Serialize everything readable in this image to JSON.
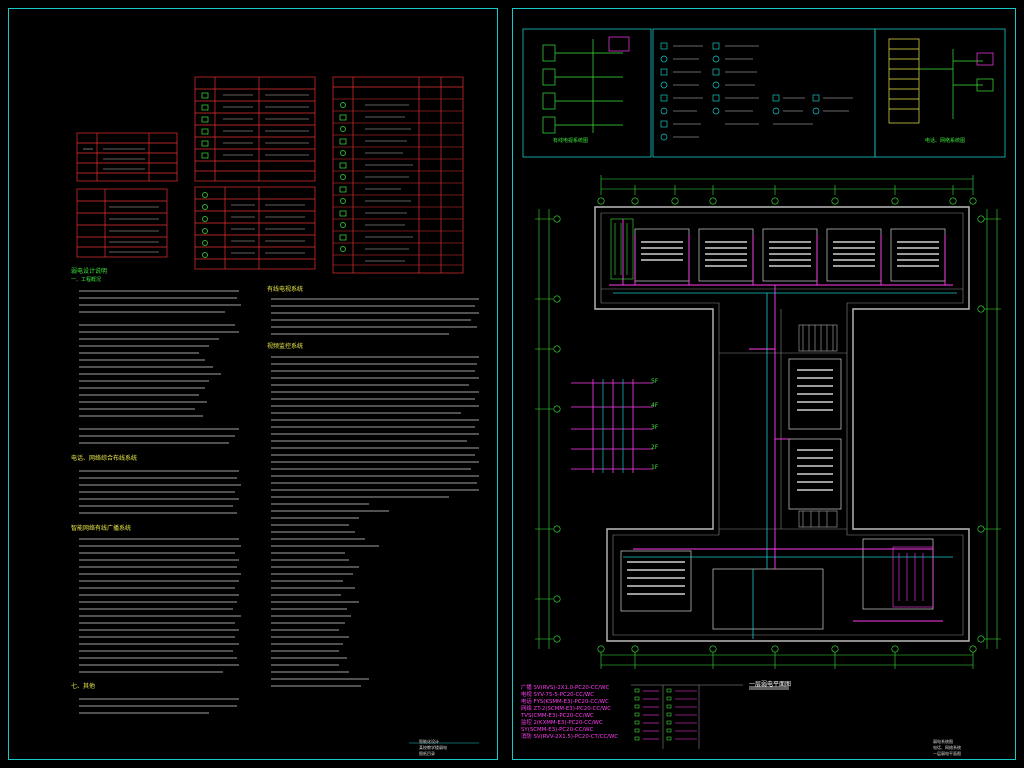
{
  "left_sheet": {
    "title_block": [
      "智能化设计",
      "某校教学楼弱电",
      "图纸目录"
    ],
    "headings": {
      "design_notes": "弱电设计说明",
      "general": "一、工程概况",
      "network": "电话、网络综合布线系统",
      "cable_tv": "有线电视系统",
      "monitor": "视频监控系统",
      "broadcast": "智能网络有线广播系统",
      "notes": "七、其他"
    }
  },
  "right_sheet": {
    "plan_title": "一层弱电平面图",
    "title_block": [
      "弱电系统图",
      "电话、网络系统",
      "一层弱电平面图"
    ],
    "top_left_diagram_caption": "有线电视系统图",
    "top_right_diagram_caption": "电话、网络系统图",
    "floor_labels": [
      "5F",
      "4F",
      "3F",
      "2F",
      "1F"
    ],
    "legend": [
      "广播 SV(RVS)-2X1.0-PC20-CC/WC",
      "电视 SYV-75-5-PC20-CC/WC",
      "电话 FYS(KSMM-E3)-PC20-CC/WC",
      "网络 ZT-2(SCMM-E3)-PC20-CC/WC",
      "TVS(CMM-E3)-PC20-CC/WC",
      "监控 2(KXMM-E3)-PC20-CC/WC",
      "SY(SCMM-E3)-PC20-CC/WC",
      "消防 SV(RVV-2X1.5)-PC20-CT/CC/WC"
    ]
  }
}
